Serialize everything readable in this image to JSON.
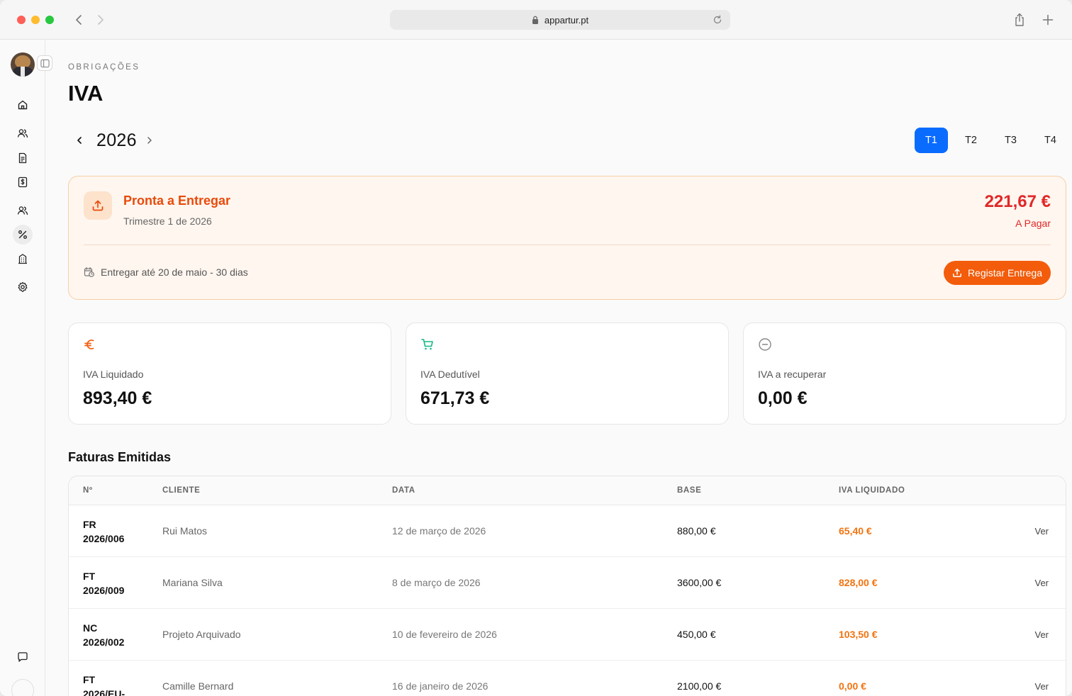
{
  "browser": {
    "url": "appartur.pt"
  },
  "sidebar": {
    "items": [
      {
        "name": "home-icon"
      },
      {
        "name": "users-icon"
      },
      {
        "name": "document-icon"
      },
      {
        "name": "invoice-icon"
      },
      {
        "name": "team-icon"
      },
      {
        "name": "percent-icon",
        "active": true
      },
      {
        "name": "building-icon"
      },
      {
        "name": "settings-icon"
      }
    ]
  },
  "header": {
    "eyebrow": "OBRIGAÇÕES",
    "title": "IVA",
    "year": "2026",
    "quarters": [
      "T1",
      "T2",
      "T3",
      "T4"
    ],
    "active_quarter": "T1"
  },
  "status": {
    "title": "Pronta a Entregar",
    "subtitle": "Trimestre 1 de 2026",
    "amount": "221,67 €",
    "amount_label": "A Pagar",
    "deadline": "Entregar até 20 de maio - 30 dias",
    "button_label": "Registar Entrega"
  },
  "stats": [
    {
      "icon": "euro-icon",
      "label": "IVA Liquidado",
      "value": "893,40 €",
      "color": "#f25c0b"
    },
    {
      "icon": "cart-icon",
      "label": "IVA Dedutível",
      "value": "671,73 €",
      "color": "#12b886"
    },
    {
      "icon": "minus-circle-icon",
      "label": "IVA a recuperar",
      "value": "0,00 €",
      "color": "#777777"
    }
  ],
  "invoices": {
    "title": "Faturas Emitidas",
    "columns": [
      "Nº",
      "CLIENTE",
      "DATA",
      "BASE",
      "IVA LIQUIDADO"
    ],
    "action_label": "Ver",
    "rows": [
      {
        "num1": "FR",
        "num2": "2026/006",
        "client": "Rui Matos",
        "date": "12 de março de 2026",
        "base": "880,00 €",
        "iva": "65,40 €"
      },
      {
        "num1": "FT",
        "num2": "2026/009",
        "client": "Mariana Silva",
        "date": "8 de março de 2026",
        "base": "3600,00 €",
        "iva": "828,00 €"
      },
      {
        "num1": "NC",
        "num2": "2026/002",
        "client": "Projeto Arquivado",
        "date": "10 de fevereiro de 2026",
        "base": "450,00 €",
        "iva": "103,50 €"
      },
      {
        "num1": "FT",
        "num2": "2026/EU-",
        "client": "Camille Bernard",
        "date": "16 de janeiro de 2026",
        "base": "2100,00 €",
        "iva": "0,00 €"
      }
    ]
  }
}
